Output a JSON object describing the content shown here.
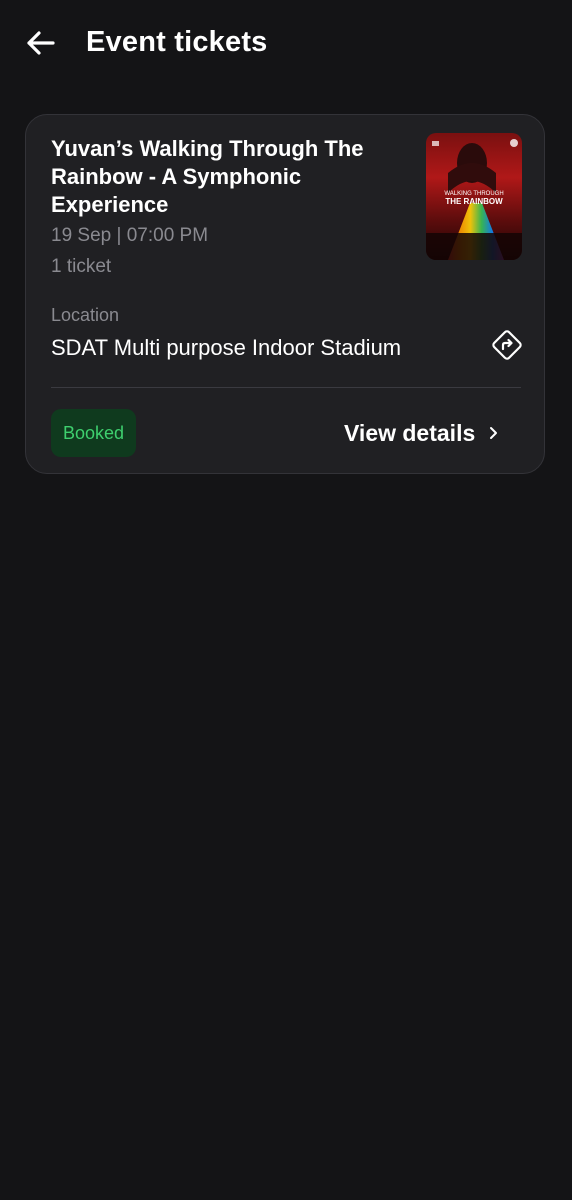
{
  "header": {
    "title": "Event tickets",
    "back_icon": "arrow-left-icon"
  },
  "ticket": {
    "title": "Yuvan’s Walking Through The Rainbow - A Symphonic Experience",
    "datetime": "19 Sep | 07:00 PM",
    "tickets": "1 ticket",
    "location_label": "Location",
    "location": "SDAT Multi purpose Indoor Stadium",
    "directions_icon": "directions-icon",
    "status": "Booked",
    "view_details_label": "View details",
    "chevron_icon": "chevron-right-icon",
    "poster": {
      "title_line1": "WALKING THROUGH",
      "title_line2": "THE RAINBOW"
    }
  },
  "colors": {
    "background": "#141416",
    "card": "#202023",
    "status_text": "#3ecf6e",
    "status_bg": "#0f3a1e",
    "muted_text": "#8a8a90"
  }
}
